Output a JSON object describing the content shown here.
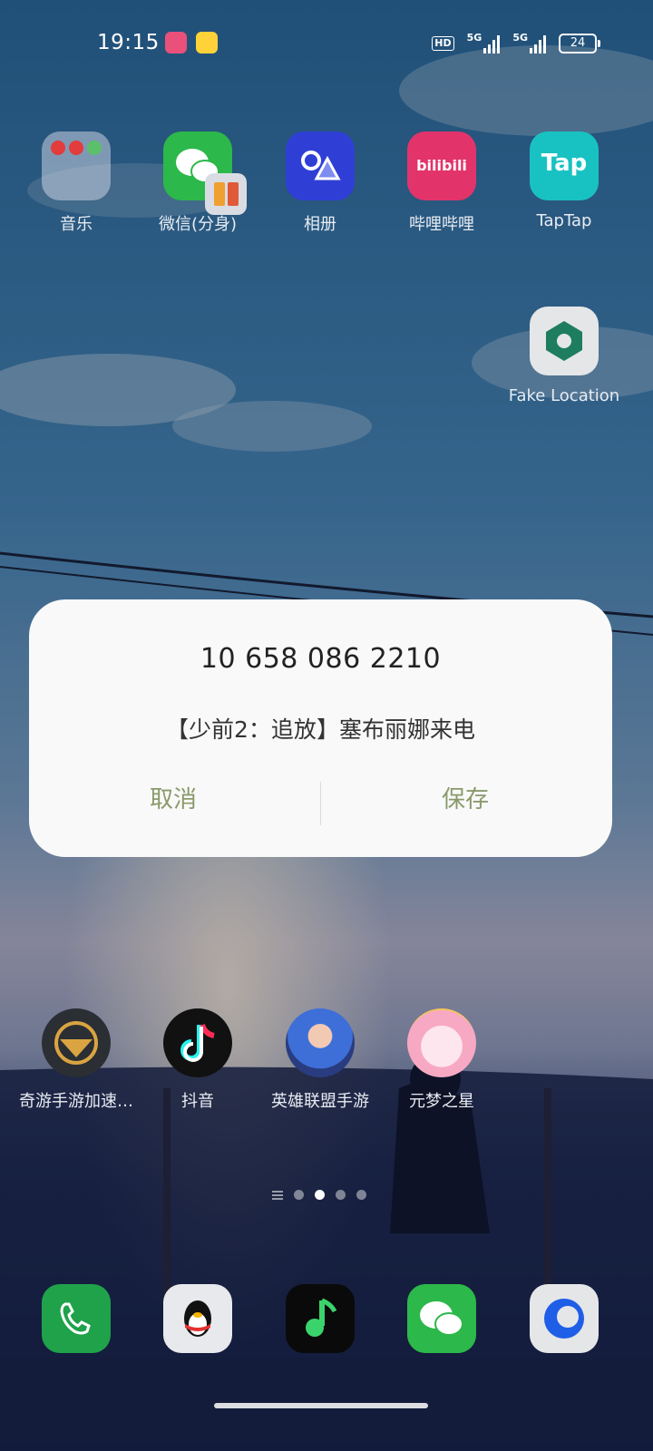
{
  "status_bar": {
    "time": "19:15",
    "hd_badge": "HD",
    "network_1": "5G",
    "network_2": "5G",
    "battery": "24"
  },
  "home_row1": [
    {
      "label": "音乐"
    },
    {
      "label": "微信(分身)"
    },
    {
      "label": "相册"
    },
    {
      "label": "哔哩哔哩"
    },
    {
      "label": "TapTap"
    }
  ],
  "bilibili_icon_text": "bilibili",
  "taptap_icon_text": "Tap",
  "fake_location": {
    "label": "Fake Location"
  },
  "home_row2": [
    {
      "label": "奇游手游加速…"
    },
    {
      "label": "抖音"
    },
    {
      "label": "英雄联盟手游"
    },
    {
      "label": "元梦之星"
    }
  ],
  "dialog": {
    "title": "10 658 086 2210",
    "message": "【少前2：追放】塞布丽娜来电",
    "cancel_label": "取消",
    "save_label": "保存"
  },
  "page_indicator": {
    "pages": 3,
    "active": 1
  },
  "colors": {
    "dialog_button": "#8a9a6b",
    "dialog_bg": "#f9f9f9"
  }
}
